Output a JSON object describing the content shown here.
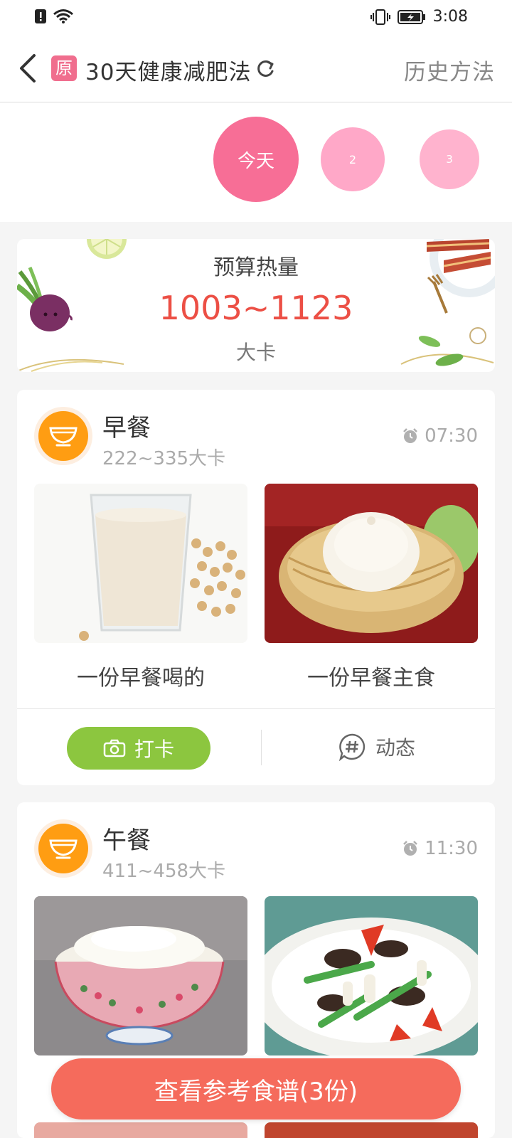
{
  "status": {
    "time": "3:08"
  },
  "header": {
    "badge": "原",
    "title": "30天健康减肥法",
    "history_label": "历史方法"
  },
  "days": [
    {
      "label": "今天",
      "selected": true
    },
    {
      "label": "2",
      "selected": false
    },
    {
      "label": "3",
      "selected": false
    }
  ],
  "budget": {
    "label": "预算热量",
    "value": "1003~1123",
    "unit": "大卡"
  },
  "meals": {
    "breakfast": {
      "name": "早餐",
      "kcal": "222~335大卡",
      "time": "07:30",
      "foods": [
        "一份早餐喝的",
        "一份早餐主食"
      ],
      "checkin_label": "打卡",
      "dynamic_label": "动态"
    },
    "lunch": {
      "name": "午餐",
      "kcal": "411~458大卡",
      "time": "11:30"
    }
  },
  "recipe_button": "查看参考食谱(3份)",
  "colors": {
    "accent_pink": "#f76e96",
    "kcal_red": "#ec4f45",
    "checkin_green": "#8cc63f",
    "meal_orange": "#ff9d12",
    "recipe_button": "#f56b5c"
  },
  "icons": [
    "alert-icon",
    "wifi-icon",
    "vibrate-icon",
    "battery-icon",
    "back-icon",
    "refresh-icon",
    "bowl-icon",
    "alarm-icon",
    "camera-icon",
    "hashtag-chat-icon"
  ]
}
